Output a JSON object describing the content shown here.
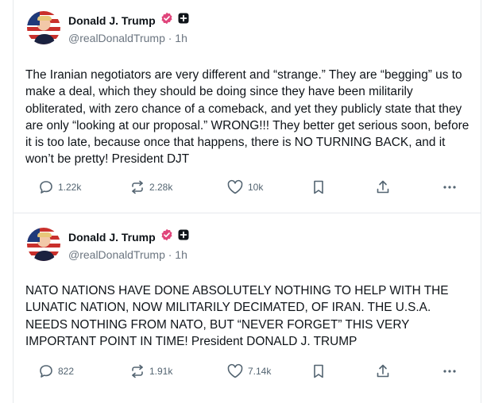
{
  "posts": [
    {
      "name": "Donald J. Trump",
      "handle": "@realDonaldTrump",
      "time": "· 1h",
      "text": "The Iranian negotiators are very different and “strange.” They are “begging” us to make a deal, which they should be doing since they have been militarily obliterated, with zero chance of a comeback, and yet they publicly state that they are only “looking at our proposal.” WRONG!!! They better get serious soon, before it is too late, because once that happens, there is NO TURNING BACK, and it won’t be pretty! President DJT",
      "replies": "1.22k",
      "reposts": "2.28k",
      "likes": "10k"
    },
    {
      "name": "Donald J. Trump",
      "handle": "@realDonaldTrump",
      "time": "· 1h",
      "text": "NATO NATIONS HAVE DONE ABSOLUTELY NOTHING TO HELP WITH THE LUNATIC NATION, NOW MILITARILY DECIMATED, OF IRAN. THE U.S.A. NEEDS NOTHING FROM NATO, BUT “NEVER FORGET” THIS VERY IMPORTANT POINT IN TIME! President DONALD J. TRUMP",
      "replies": "822",
      "reposts": "1.91k",
      "likes": "7.14k"
    }
  ],
  "colors": {
    "text": "#0f1419",
    "muted": "#6b7580",
    "verified": "#e0457b",
    "divider": "#e6e9ec"
  },
  "icons": [
    "avatar",
    "verified-badge-icon",
    "plus-badge-icon",
    "reply-icon",
    "repost-icon",
    "like-icon",
    "bookmark-icon",
    "share-icon",
    "more-icon"
  ]
}
